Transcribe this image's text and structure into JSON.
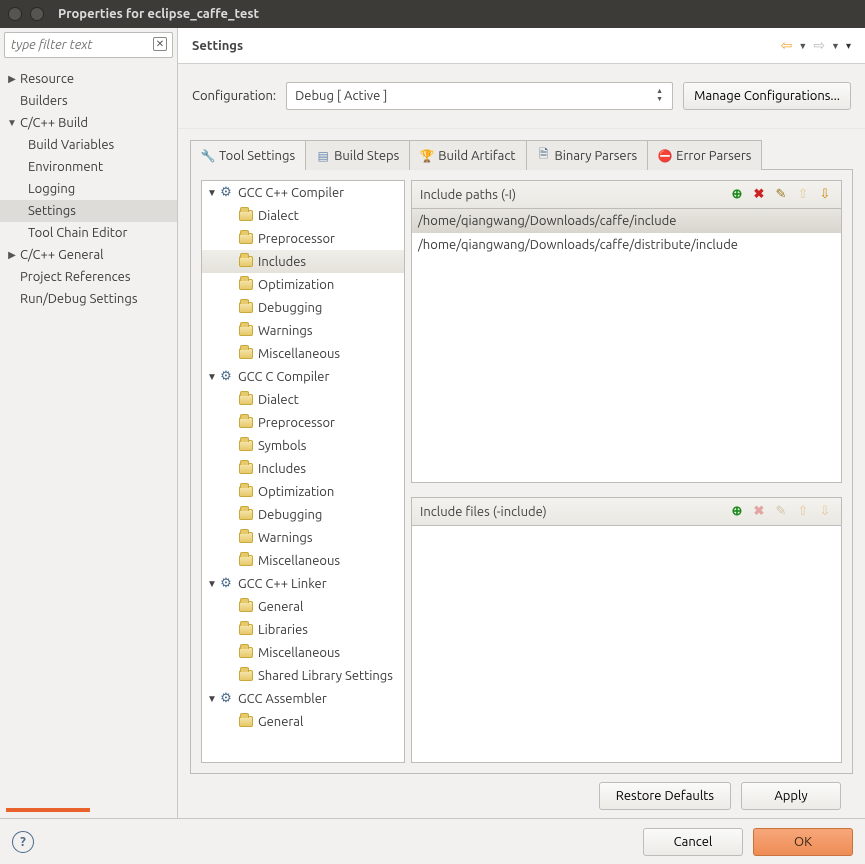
{
  "window": {
    "title": "Properties for eclipse_caffe_test"
  },
  "sidebar": {
    "filter_placeholder": "type filter text",
    "items": [
      {
        "label": "Resource",
        "expandable": true
      },
      {
        "label": "Builders",
        "expandable": false
      },
      {
        "label": "C/C++ Build",
        "expandable": true,
        "expanded": true,
        "children": [
          {
            "label": "Build Variables"
          },
          {
            "label": "Environment"
          },
          {
            "label": "Logging"
          },
          {
            "label": "Settings",
            "selected": true
          },
          {
            "label": "Tool Chain Editor"
          }
        ]
      },
      {
        "label": "C/C++ General",
        "expandable": true
      },
      {
        "label": "Project References",
        "expandable": false
      },
      {
        "label": "Run/Debug Settings",
        "expandable": false
      }
    ]
  },
  "header": {
    "title": "Settings"
  },
  "config": {
    "label": "Configuration:",
    "value": "Debug  [ Active ]",
    "manage_btn": "Manage Configurations..."
  },
  "tabs": [
    {
      "label": "Tool Settings",
      "active": true,
      "icon": "wrench"
    },
    {
      "label": "Build Steps",
      "icon": "steps"
    },
    {
      "label": "Build Artifact",
      "icon": "trophy"
    },
    {
      "label": "Binary Parsers",
      "icon": "binparser"
    },
    {
      "label": "Error Parsers",
      "icon": "error"
    }
  ],
  "tool_tree": [
    {
      "label": "GCC C++ Compiler",
      "type": "group",
      "children": [
        {
          "label": "Dialect"
        },
        {
          "label": "Preprocessor"
        },
        {
          "label": "Includes",
          "selected": true
        },
        {
          "label": "Optimization"
        },
        {
          "label": "Debugging"
        },
        {
          "label": "Warnings"
        },
        {
          "label": "Miscellaneous"
        }
      ]
    },
    {
      "label": "GCC C Compiler",
      "type": "group",
      "children": [
        {
          "label": "Dialect"
        },
        {
          "label": "Preprocessor"
        },
        {
          "label": "Symbols"
        },
        {
          "label": "Includes"
        },
        {
          "label": "Optimization"
        },
        {
          "label": "Debugging"
        },
        {
          "label": "Warnings"
        },
        {
          "label": "Miscellaneous"
        }
      ]
    },
    {
      "label": "GCC C++ Linker",
      "type": "group",
      "children": [
        {
          "label": "General"
        },
        {
          "label": "Libraries"
        },
        {
          "label": "Miscellaneous"
        },
        {
          "label": "Shared Library Settings"
        }
      ]
    },
    {
      "label": "GCC Assembler",
      "type": "group",
      "children": [
        {
          "label": "General"
        }
      ]
    }
  ],
  "include_paths": {
    "title": "Include paths (-I)",
    "items": [
      {
        "value": "/home/qiangwang/Downloads/caffe/include",
        "selected": true
      },
      {
        "value": "/home/qiangwang/Downloads/caffe/distribute/include"
      }
    ]
  },
  "include_files": {
    "title": "Include files (-include)",
    "items": []
  },
  "buttons": {
    "restore": "Restore Defaults",
    "apply": "Apply",
    "cancel": "Cancel",
    "ok": "OK"
  }
}
